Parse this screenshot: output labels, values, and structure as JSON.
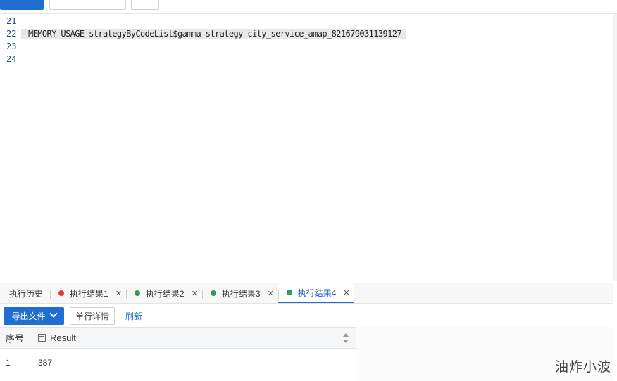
{
  "editor": {
    "lines": [
      {
        "no": "21",
        "code": ""
      },
      {
        "no": "22",
        "code": "MEMORY USAGE strategyByCodeList$gamma-strategy-city_service_amap_821679031139127"
      },
      {
        "no": "23",
        "code": ""
      },
      {
        "no": "24",
        "code": ""
      }
    ]
  },
  "tabs": [
    {
      "label": "执行历史",
      "status": "none"
    },
    {
      "label": "执行结果1",
      "status": "error",
      "color": "#e0393e"
    },
    {
      "label": "执行结果2",
      "status": "success",
      "color": "#2f9b5a"
    },
    {
      "label": "执行结果3",
      "status": "success",
      "color": "#2f9b5a"
    },
    {
      "label": "执行结果4",
      "status": "success",
      "color": "#2f9b5a",
      "active": true
    }
  ],
  "toolbar": {
    "export_label": "导出文件",
    "detail_label": "单行详情",
    "refresh_label": "刷新"
  },
  "grid": {
    "columns": [
      "序号",
      "Result"
    ],
    "rows": [
      {
        "idx": "1",
        "result": "387"
      }
    ]
  },
  "watermark": "油炸小波",
  "colors": {
    "accent": "#1f6fd1",
    "error_dot": "#e0393e",
    "success_dot": "#2f9b5a"
  }
}
